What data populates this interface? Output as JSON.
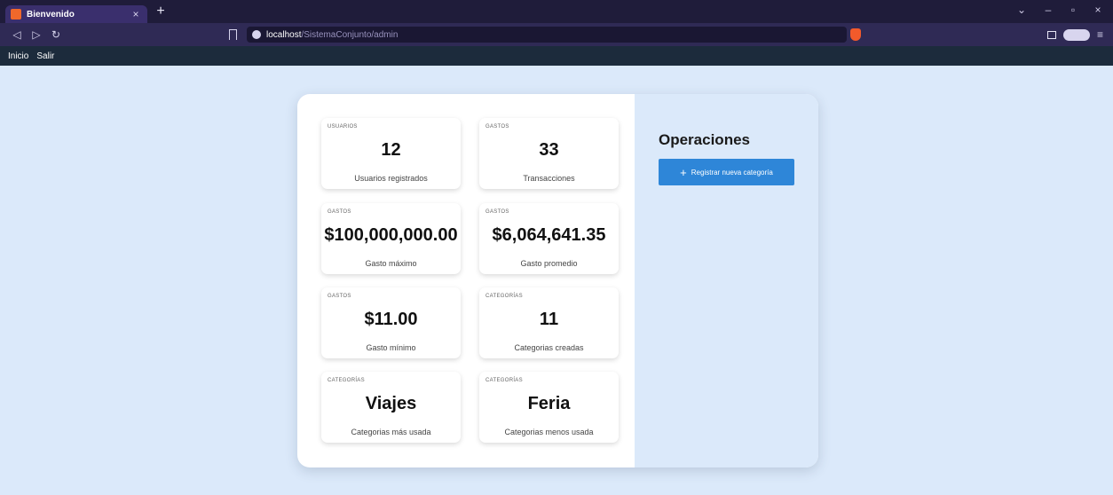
{
  "browser": {
    "tab_title": "Bienvenido",
    "tab_close": "×",
    "new_tab": "+",
    "url_host": "localhost",
    "url_path": "/SistemaConjunto/admin",
    "controls": {
      "chevron": "⌄",
      "minimize": "–",
      "restore": "▫",
      "close": "×"
    },
    "nav": {
      "back": "◁",
      "forward": "▷",
      "reload": "↻",
      "menu": "≡"
    }
  },
  "site_nav": {
    "items": [
      {
        "label": "Inicio"
      },
      {
        "label": "Salir"
      }
    ]
  },
  "stats": [
    {
      "category": "USUARIOS",
      "value": "12",
      "label": "Usuarios registrados"
    },
    {
      "category": "GASTOS",
      "value": "33",
      "label": "Transacciones"
    },
    {
      "category": "GASTOS",
      "value": "$100,000,000.00",
      "label": "Gasto máximo"
    },
    {
      "category": "GASTOS",
      "value": "$6,064,641.35",
      "label": "Gasto promedio"
    },
    {
      "category": "GASTOS",
      "value": "$11.00",
      "label": "Gasto mínimo"
    },
    {
      "category": "CATEGORÍAS",
      "value": "11",
      "label": "Categorias creadas"
    },
    {
      "category": "CATEGORÍAS",
      "value": "Viajes",
      "label": "Categorias más usada"
    },
    {
      "category": "CATEGORÍAS",
      "value": "Feria",
      "label": "Categorias menos usada"
    }
  ],
  "operations": {
    "title": "Operaciones",
    "add_button_label": "Registrar nueva categoría",
    "add_button_icon": "+"
  },
  "colors": {
    "page_bg": "#dbe9fa",
    "nav_bg": "#1c2b3c",
    "button_accent": "#2e86d8"
  }
}
